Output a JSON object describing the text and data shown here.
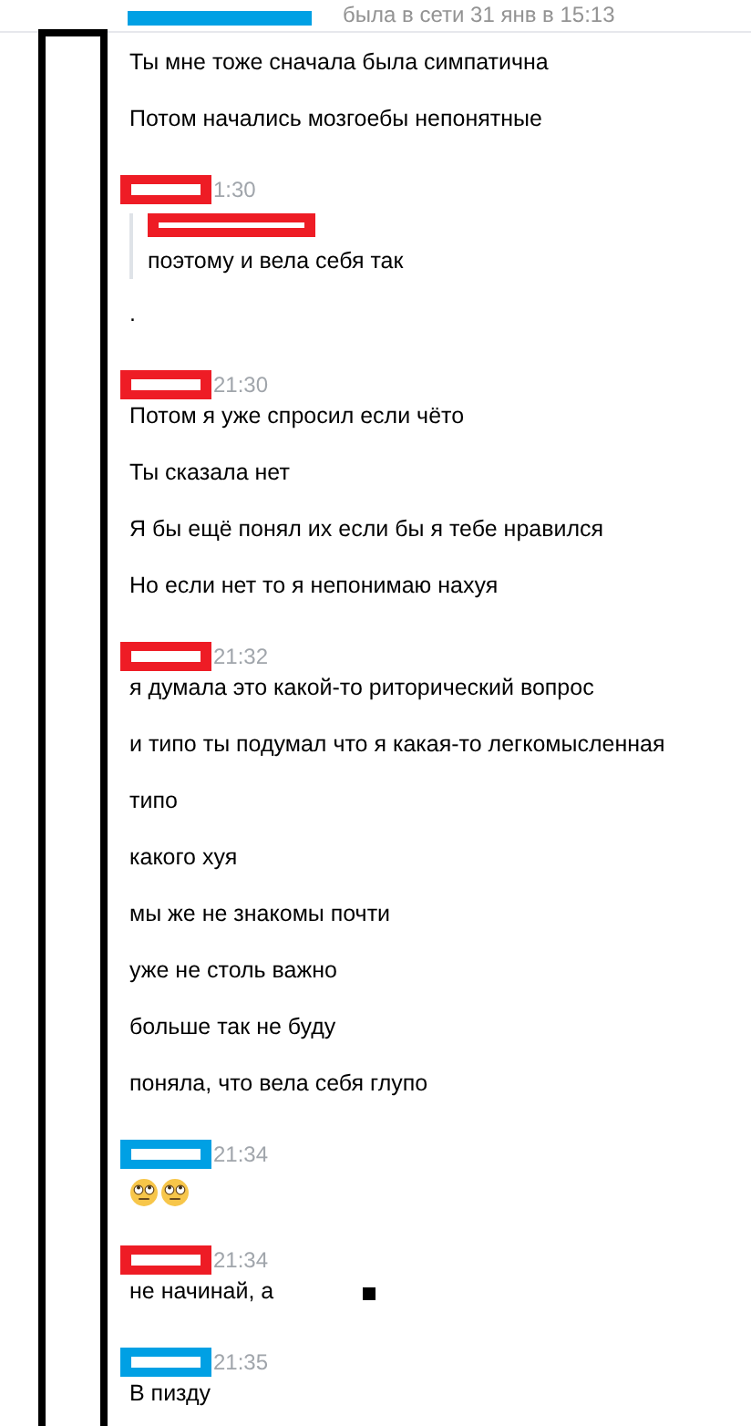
{
  "header": {
    "status": "была в сети 31 янв в 15:13"
  },
  "groups": [
    {
      "color": "#00a0e4",
      "messages": [
        {
          "kind": "text",
          "text": "Ты мне тоже сначала была симпатична"
        },
        {
          "kind": "text",
          "text": "Потом начались мозгоебы непонятные"
        }
      ]
    },
    {
      "color": "#ee1c25",
      "time": "1:30",
      "messages": [
        {
          "kind": "quote",
          "color": "#ee1c25",
          "text": "поэтому и вела себя так"
        },
        {
          "kind": "text",
          "text": "."
        }
      ]
    },
    {
      "color": "#ee1c25",
      "time": "21:30",
      "messages": [
        {
          "kind": "text",
          "text": "Потом я уже спросил если чёто"
        },
        {
          "kind": "text",
          "text": "Ты сказала нет"
        },
        {
          "kind": "text",
          "text": "Я бы ещё понял их если бы я тебе нравился"
        },
        {
          "kind": "text",
          "text": "Но если нет то я непонимаю нахуя"
        }
      ]
    },
    {
      "color": "#ee1c25",
      "time": "21:32",
      "messages": [
        {
          "kind": "text",
          "text": "я думала это какой-то риторический вопрос"
        },
        {
          "kind": "text",
          "text": "и типо ты подумал что я какая-то легкомысленная"
        },
        {
          "kind": "text",
          "text": "типо"
        },
        {
          "kind": "text",
          "text": "какого хуя"
        },
        {
          "kind": "text",
          "text": "мы же не знакомы почти"
        },
        {
          "kind": "text",
          "text": "уже не столь важно"
        },
        {
          "kind": "text",
          "text": "больше так не буду"
        },
        {
          "kind": "text",
          "text": "поняла, что вела себя глупо"
        }
      ]
    },
    {
      "color": "#00a0e4",
      "time": "21:34",
      "messages": [
        {
          "kind": "emojis",
          "emojis": [
            {
              "kind": "eye-roll"
            },
            {
              "kind": "eye-roll"
            }
          ]
        }
      ]
    },
    {
      "color": "#ee1c25",
      "time": "21:34",
      "messages": [
        {
          "kind": "text",
          "text": "не начинай, а"
        }
      ]
    },
    {
      "color": "#00a0e4",
      "time": "21:35",
      "messages": [
        {
          "kind": "text",
          "text": "В пизду"
        }
      ]
    }
  ]
}
